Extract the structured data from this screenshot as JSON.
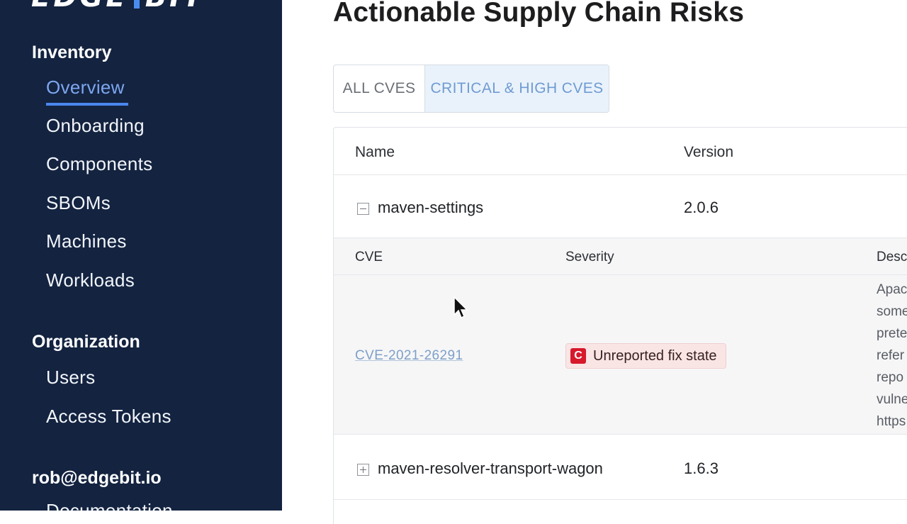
{
  "sidebar": {
    "logo_text": "EDGE",
    "logo_text_2": "BIT",
    "sections": {
      "inventory": {
        "title": "Inventory",
        "items": [
          "Overview",
          "Onboarding",
          "Components",
          "SBOMs",
          "Machines",
          "Workloads"
        ],
        "active": "Overview"
      },
      "organization": {
        "title": "Organization",
        "items": [
          "Users",
          "Access Tokens"
        ]
      },
      "account": {
        "title": "rob@edgebit.io",
        "items": [
          "Documentation"
        ]
      }
    }
  },
  "main": {
    "title": "Actionable Supply Chain Risks",
    "tabs": [
      {
        "label": "ALL CVES",
        "selected": false
      },
      {
        "label": "CRITICAL & HIGH CVES",
        "selected": true
      }
    ],
    "table": {
      "columns": [
        "Name",
        "Version"
      ],
      "rows": [
        {
          "name": "maven-settings",
          "version": "2.0.6",
          "expanded": true,
          "cves": {
            "columns": [
              "CVE",
              "Severity",
              "Desc"
            ],
            "items": [
              {
                "id": "CVE-2021-26291",
                "severity_letter": "C",
                "severity_text": "Unreported fix state",
                "description_lines": [
                  "Apac",
                  "some",
                  "prete",
                  "refer",
                  "repo",
                  "vulne",
                  "https"
                ]
              }
            ]
          }
        },
        {
          "name": "maven-resolver-transport-wagon",
          "version": "1.6.3",
          "expanded": false
        }
      ]
    }
  },
  "colors": {
    "sidebar_bg": "#132340",
    "accent": "#4a86ee",
    "critical": "#d7192c",
    "selected_tab_bg": "#e9f2fb"
  }
}
